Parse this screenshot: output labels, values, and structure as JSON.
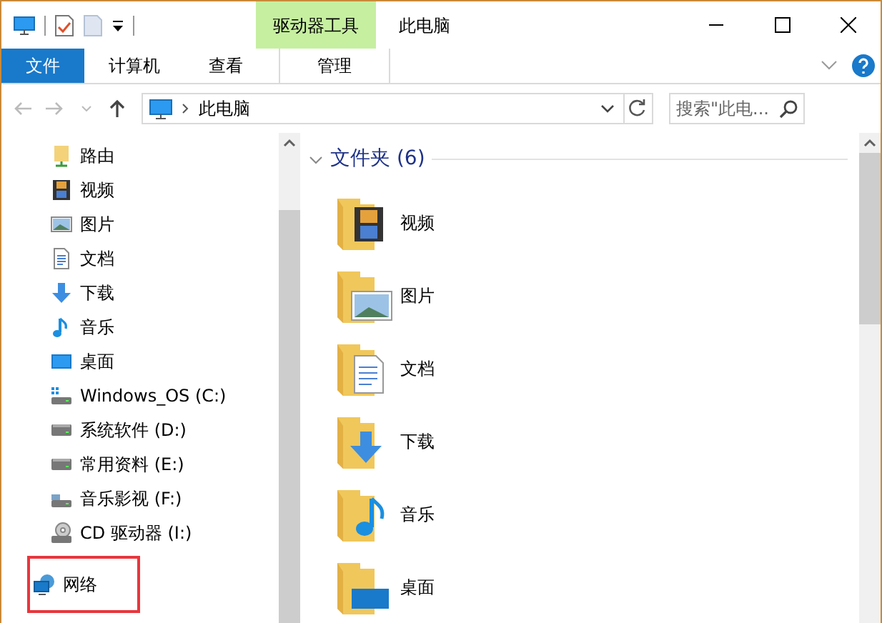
{
  "window": {
    "title": "此电脑",
    "context_tab_group": "驱动器工具"
  },
  "ribbon_tabs": [
    {
      "label": "文件",
      "kind": "file"
    },
    {
      "label": "计算机",
      "kind": "tab"
    },
    {
      "label": "查看",
      "kind": "tab"
    },
    {
      "label": "管理",
      "kind": "context"
    }
  ],
  "address_bar": {
    "path": "此电脑",
    "search_placeholder": "搜索\"此电..."
  },
  "navigation_pane": {
    "items": [
      {
        "label": "路由",
        "outlined": false
      },
      {
        "label": "视频",
        "outlined": false
      },
      {
        "label": "图片",
        "outlined": false
      },
      {
        "label": "文档",
        "outlined": false
      },
      {
        "label": "下载",
        "outlined": false
      },
      {
        "label": "音乐",
        "outlined": false
      },
      {
        "label": "桌面",
        "outlined": false
      },
      {
        "label": "Windows_OS (C:)",
        "outlined": false
      },
      {
        "label": "系统软件 (D:)",
        "outlined": false
      },
      {
        "label": "常用资料 (E:)",
        "outlined": false
      },
      {
        "label": "音乐影视 (F:)",
        "outlined": false
      },
      {
        "label": "CD 驱动器 (I:)",
        "outlined": false
      },
      {
        "label": "网络",
        "outlined": true
      }
    ]
  },
  "content": {
    "group": {
      "title": "文件夹 (6)",
      "expanded": true
    },
    "folders": [
      {
        "label": "视频"
      },
      {
        "label": "图片"
      },
      {
        "label": "文档"
      },
      {
        "label": "下载"
      },
      {
        "label": "音乐"
      },
      {
        "label": "桌面"
      }
    ]
  }
}
